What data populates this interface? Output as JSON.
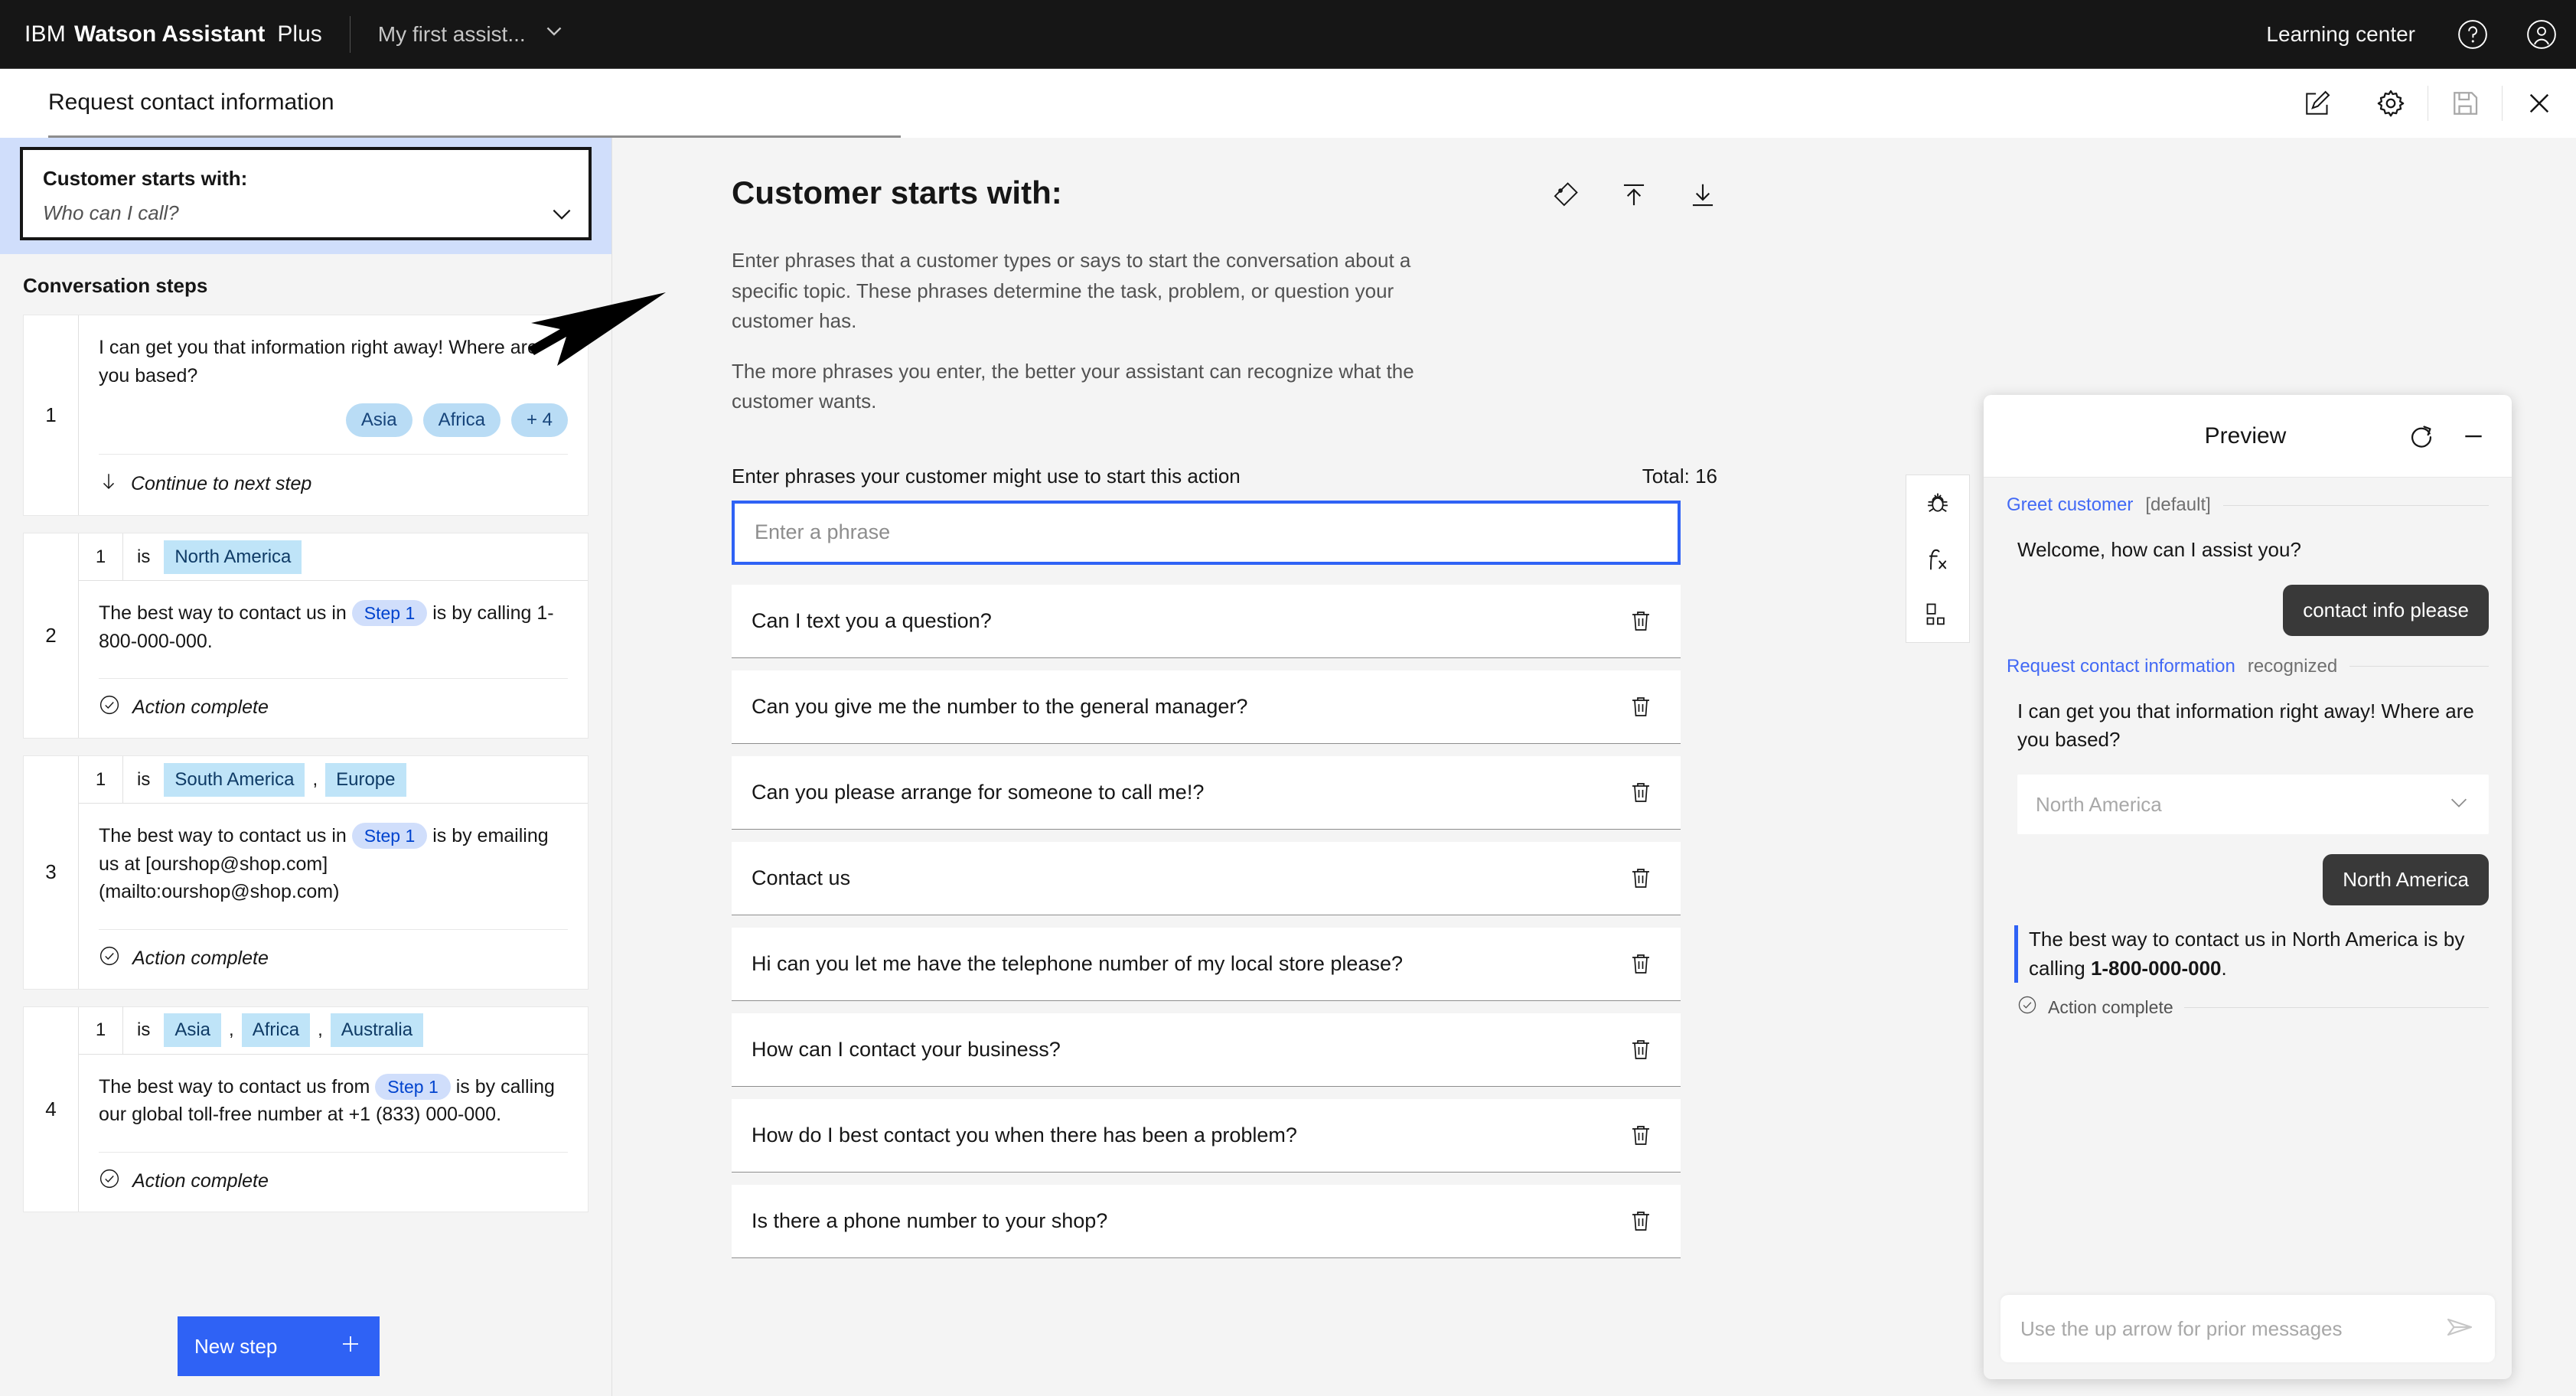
{
  "topbar": {
    "ibm": "IBM",
    "product": "Watson Assistant",
    "plan": "Plus",
    "assistant_name": "My first assist...",
    "learning_center": "Learning center",
    "icons": {
      "help": "help-icon",
      "account": "user-avatar-icon"
    }
  },
  "subbar": {
    "title": "Request contact information",
    "actions": [
      "edit-icon",
      "settings-gear-icon",
      "save-icon",
      "close-icon"
    ]
  },
  "sidebar": {
    "starts_with": {
      "title": "Customer starts with:",
      "example": "Who can I call?"
    },
    "section_title": "Conversation steps",
    "new_step_label": "New step",
    "steps": [
      {
        "number": "1",
        "text": "I can get you that information right away! Where are you based?",
        "options": [
          "Asia",
          "Africa",
          "+ 4"
        ],
        "footer": "Continue to next step",
        "conditions": []
      },
      {
        "number": "2",
        "condition": {
          "variable": "1",
          "operator": "is",
          "values": [
            "North America"
          ]
        },
        "text_before": "The best way to contact us in",
        "step_ref": "Step 1",
        "text_after": "is by calling 1-800-000-000.",
        "footer": "Action complete"
      },
      {
        "number": "3",
        "condition": {
          "variable": "1",
          "operator": "is",
          "values": [
            "South America",
            "Europe"
          ]
        },
        "text_before": "The best way to contact us in",
        "step_ref": "Step 1",
        "text_after": "is by emailing us at [ourshop@shop.com](mailto:ourshop@shop.com)",
        "footer": "Action complete"
      },
      {
        "number": "4",
        "condition": {
          "variable": "1",
          "operator": "is",
          "values": [
            "Asia",
            "Africa",
            "Australia"
          ]
        },
        "text_before": "The best way to contact us from",
        "step_ref": "Step 1",
        "text_after": "is by calling our global toll-free number at +1 (833) 000-000.",
        "footer": "Action complete"
      }
    ]
  },
  "main": {
    "title": "Customer starts with:",
    "head_icons": [
      "tag-icon",
      "upload-icon",
      "download-icon"
    ],
    "description_1": "Enter phrases that a customer types or says to start the conversation about a specific topic. These phrases determine the task, problem, or question your customer has.",
    "description_2": "The more phrases you enter, the better your assistant can recognize what the customer wants.",
    "phrase_label": "Enter phrases your customer might use to start this action",
    "total_label": "Total: 16",
    "input_placeholder": "Enter a phrase",
    "input_value": "",
    "phrases": [
      "Can I text you a question?",
      "Can you give me the number to the general manager?",
      "Can you please arrange for someone to call me!?",
      "Contact us",
      "Hi can you let me have the telephone number of my local store please?",
      "How can I contact your business?",
      "How do I best contact you when there has been a problem?",
      "Is there a phone number to your shop?"
    ]
  },
  "rail": {
    "icons": [
      "bug-icon",
      "function-fx-icon",
      "variables-grid-icon"
    ]
  },
  "preview": {
    "title": "Preview",
    "restart_icon": "restart-icon",
    "minimize_icon": "minimize-icon",
    "markers": [
      {
        "link": "Greet customer",
        "suffix": "[default]"
      },
      {
        "link": "Request contact information",
        "suffix": "recognized"
      }
    ],
    "bot_greeting": "Welcome, how can I assist you?",
    "user_msg_1": "contact info please",
    "bot_question": "I can get you that information right away! Where are you based?",
    "dropdown_value": "North America",
    "user_msg_2": "North America",
    "bot_answer_prefix": "The best way to contact us in North America is by calling ",
    "bot_answer_bold": "1-800-000-000",
    "bot_answer_suffix": ".",
    "action_complete": "Action complete",
    "input_placeholder": "Use the up arrow for prior messages",
    "input_value": "",
    "send_icon": "send-icon"
  },
  "colors": {
    "brand_black": "#161616",
    "accent_blue": "#2f62f5",
    "link_blue": "#4269f5",
    "chip_blue": "#b9dcf5",
    "condition_blue": "#bfe4f8",
    "step_chip": "#d0defb"
  }
}
